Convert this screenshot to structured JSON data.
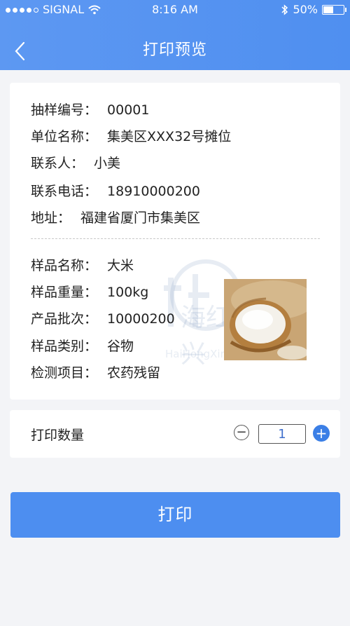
{
  "status_bar": {
    "carrier": "SIGNAL",
    "time": "8:16 AM",
    "battery": "50%"
  },
  "header": {
    "title": "打印预览"
  },
  "sample_info": [
    {
      "label": "抽样编号：",
      "value": "00001"
    },
    {
      "label": "单位名称：",
      "value": "集美区XXX32号摊位"
    },
    {
      "label": "联系人：",
      "value": "小美"
    },
    {
      "label": "联系电话：",
      "value": "18910000200"
    },
    {
      "label": "地址：",
      "value": "福建省厦门市集美区"
    }
  ],
  "product_info": [
    {
      "label": "样品名称：",
      "value": "大米"
    },
    {
      "label": "样品重量：",
      "value": "100kg"
    },
    {
      "label": "产品批次：",
      "value": "10000200"
    },
    {
      "label": "样品类别：",
      "value": "谷物"
    },
    {
      "label": "检测项目：",
      "value": "农药残留"
    }
  ],
  "watermark": {
    "main": "海红兴",
    "sub": "HaiHongXing"
  },
  "quantity": {
    "label": "打印数量",
    "value": "1"
  },
  "actions": {
    "print_label": "打印"
  },
  "colors": {
    "header": "#5d98f2",
    "primary_button": "#4d8ef0",
    "plus_button": "#3b7fe6"
  }
}
